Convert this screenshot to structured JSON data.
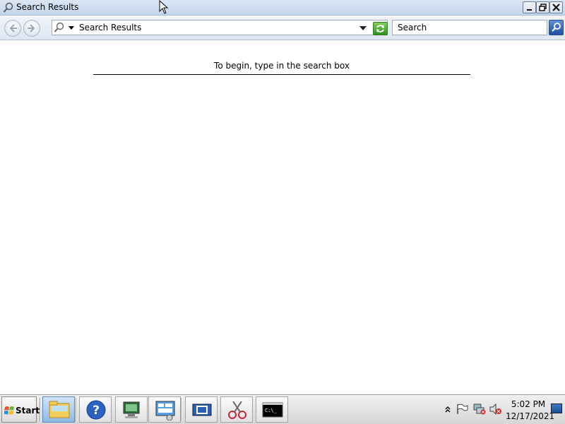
{
  "window": {
    "title": "Search Results",
    "controls": {
      "minimize": "minimize",
      "maximize": "maximize",
      "close": "close"
    }
  },
  "toolbar": {
    "address": "Search Results",
    "search_placeholder": "Search"
  },
  "content": {
    "hint": "To begin, type in the search box"
  },
  "taskbar": {
    "start_label": "Start",
    "apps": [
      "explorer-icon",
      "help-icon",
      "computer-management-icon",
      "server-manager-icon",
      "virtual-machine-icon",
      "snipping-tool-icon",
      "command-prompt-icon"
    ],
    "clock_time": "5:02 PM",
    "clock_date": "12/17/2021"
  },
  "colors": {
    "titlebar": "#c4d5ec",
    "refresh_green": "#2f8f1e",
    "search_go_blue": "#1d4fa0"
  }
}
